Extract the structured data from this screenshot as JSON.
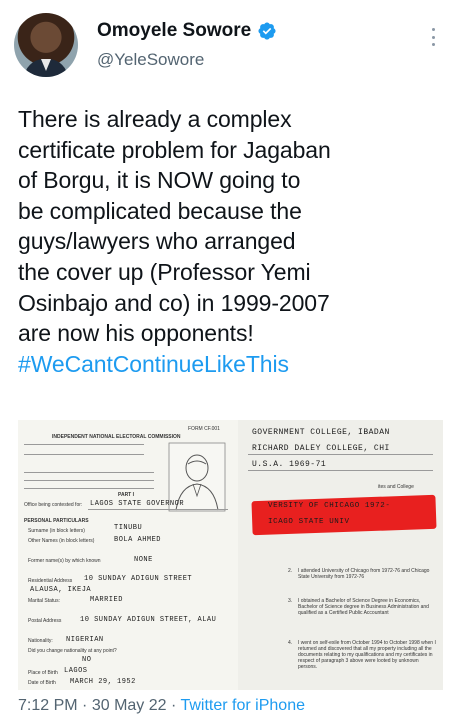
{
  "author": {
    "display_name": "Omoyele Sowore",
    "handle": "@YeleSowore",
    "verified": true
  },
  "tweet": {
    "lines": [
      "There is already a complex",
      "certificate problem for Jagaban",
      "of Borgu, it is NOW going to",
      "be complicated because the",
      "guys/lawyers who arranged",
      "the cover up (Professor Yemi",
      "Osinbajo and co) in 1999-2007",
      "are now his opponents!"
    ],
    "hashtag": "#WeCantContinueLikeThis"
  },
  "media": {
    "left_doc": {
      "heading": "INDEPENDENT NATIONAL ELECTORAL COMMISSION",
      "form_no": "FORM CF.001",
      "part": "PART I",
      "office_label": "Office being contested for:",
      "office_value": "LAGOS STATE GOVERNOR",
      "section": "PERSONAL PARTICULARS",
      "surname_label": "Surname (in block letters)",
      "surname_value": "TINUBU",
      "other_names_label": "Other Names (in block letters)",
      "other_names_value": "BOLA AHMED",
      "former_name_label": "Former name(s) by which known",
      "former_name_value": "NONE",
      "residential_label": "Residential Address",
      "residential_value": "10 SUNDAY ADIGUN STREET",
      "residential_value2": "ALAUSA, IKEJA",
      "marital_label": "Marital Status:",
      "marital_value": "MARRIED",
      "postal_label": "Postal Address",
      "postal_value": "10 SUNDAY ADIGUN STREET, ALAU",
      "nationality_label": "Nationality:",
      "nationality_value": "NIGERIAN",
      "changed_label": "Did you change nationality at any point?",
      "changed_value": "NO",
      "birthplace_label": "Place of Birth",
      "birthplace_value": "LAGOS",
      "dob_label": "Date of Birth",
      "dob_value": "MARCH 29, 1952"
    },
    "right_doc": {
      "line1": "GOVERNMENT COLLEGE, IBADAN",
      "line2": "RICHARD DALEY COLLEGE, CHI",
      "line3": "U.S.A. 1969-71",
      "red_line1": "VERSITY OF CHICAGO 1972-",
      "red_line2": "ICAGO STATE UNIV",
      "fragment": "ites and College",
      "n2": "2.",
      "p2": "I attended University of Chicago from 1972-76 and Chicago State University from 1972-76",
      "n3": "3.",
      "p3": "I obtained a Bachelor of Science Degree in Economics, Bachelor of Science degree in Business Administration and qualified as a Certified Public Accountant",
      "n4": "4.",
      "p4": "I went on self-exile from October 1994 to October 1998 when I returned and discovered that all my property including all the documents relating to my qualifications and my certificates in respect of paragraph 3 above were looted by unknown persons."
    }
  },
  "meta": {
    "time": "7:12 PM",
    "separator": "·",
    "date": "30 May 22",
    "source": "Twitter for iPhone"
  },
  "colors": {
    "link": "#1d9bf0",
    "muted": "#536471",
    "text": "#0f1419",
    "highlight": "#e8201f"
  }
}
